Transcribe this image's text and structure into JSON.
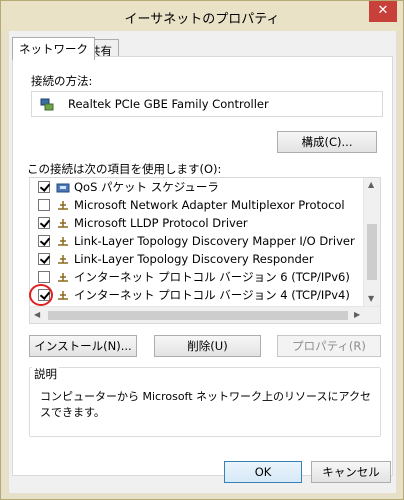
{
  "window": {
    "title": "イーサネットのプロパティ",
    "close_label": "✕"
  },
  "tabs": [
    {
      "label": "ネットワーク",
      "active": true
    },
    {
      "label": "共有",
      "active": false
    }
  ],
  "connection": {
    "label": "接続の方法:",
    "adapter_name": "Realtek PCIe GBE Family Controller",
    "configure_button": "構成(C)..."
  },
  "items_section": {
    "label": "この接続は次の項目を使用します(O):",
    "items": [
      {
        "label": "QoS パケット スケジューラ",
        "checked": true,
        "icon": "qos-icon"
      },
      {
        "label": "Microsoft Network Adapter Multiplexor Protocol",
        "checked": false,
        "icon": "protocol-icon"
      },
      {
        "label": "Microsoft LLDP Protocol Driver",
        "checked": true,
        "icon": "protocol-icon"
      },
      {
        "label": "Link-Layer Topology Discovery Mapper I/O Driver",
        "checked": true,
        "icon": "protocol-icon"
      },
      {
        "label": "Link-Layer Topology Discovery Responder",
        "checked": true,
        "icon": "protocol-icon"
      },
      {
        "label": "インターネット プロトコル バージョン 6 (TCP/IPv6)",
        "checked": false,
        "icon": "protocol-icon"
      },
      {
        "label": "インターネット プロトコル バージョン 4 (TCP/IPv4)",
        "checked": true,
        "icon": "protocol-icon"
      }
    ]
  },
  "action_buttons": {
    "install": "インストール(N)...",
    "uninstall": "削除(U)",
    "properties": "プロパティ(R)"
  },
  "description": {
    "label": "説明",
    "text": "コンピューターから Microsoft ネットワーク上のリソースにアクセスできます。"
  },
  "footer": {
    "ok": "OK",
    "cancel": "キャンセル"
  },
  "colors": {
    "title_bar": "#e9e2c7",
    "close_button": "#c7403a",
    "highlight_circle": "#e02020",
    "accent": "#3c7fb1"
  }
}
